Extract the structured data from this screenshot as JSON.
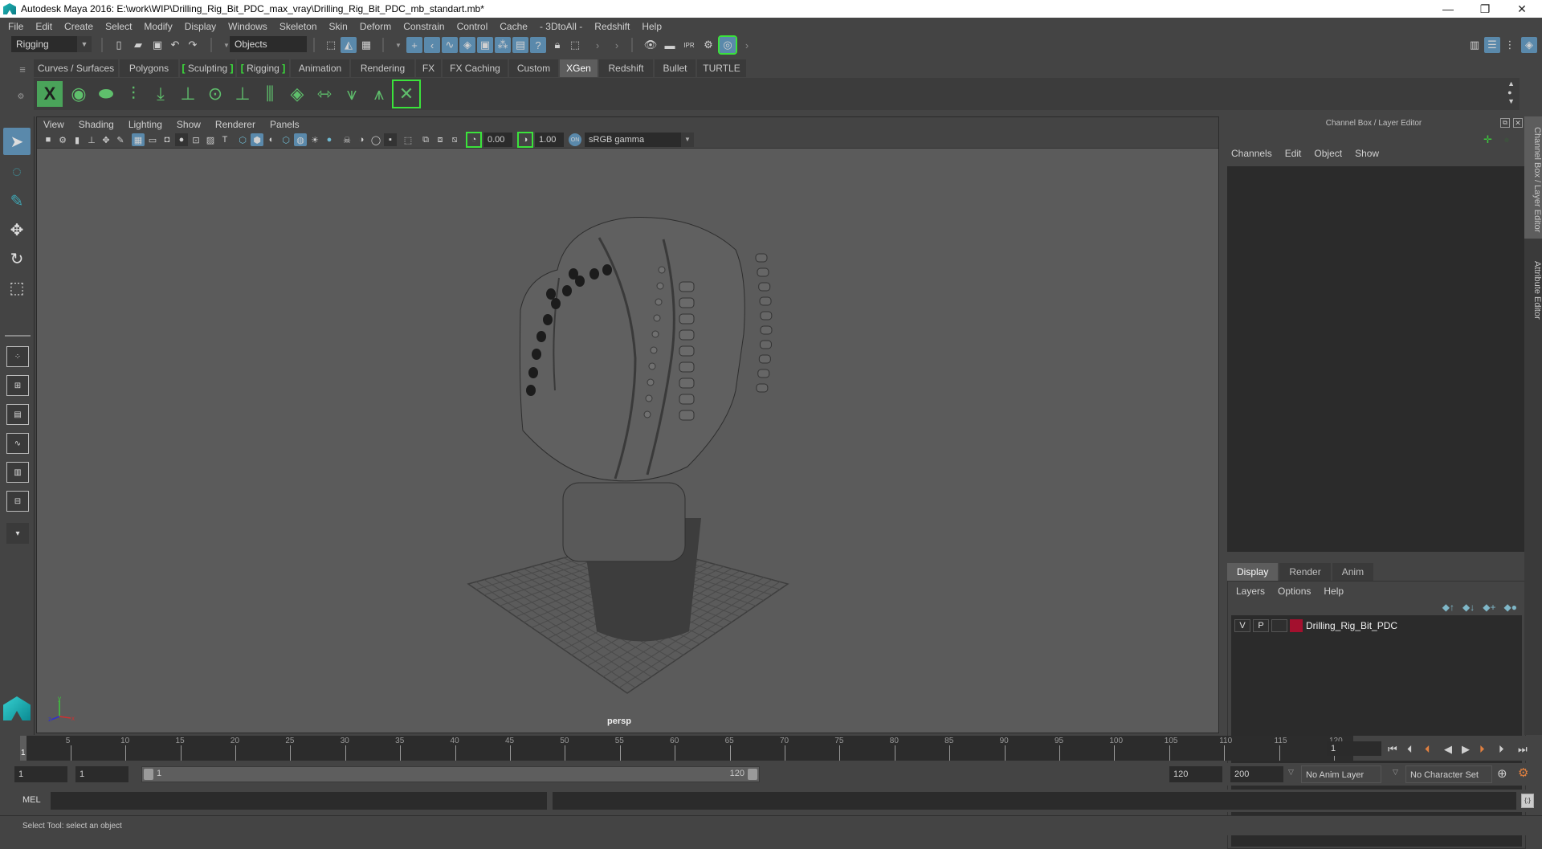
{
  "window": {
    "title": "Autodesk Maya 2016: E:\\work\\WIP\\Drilling_Rig_Bit_PDC_max_vray\\Drilling_Rig_Bit_PDC_mb_standart.mb*",
    "minimize": "—",
    "restore": "❐",
    "close": "✕"
  },
  "menubar": [
    "File",
    "Edit",
    "Create",
    "Select",
    "Modify",
    "Display",
    "Windows",
    "Skeleton",
    "Skin",
    "Deform",
    "Constrain",
    "Control",
    "Cache",
    "- 3DtoAll -",
    "Redshift",
    "Help"
  ],
  "statusline": {
    "menuset": "Rigging",
    "selection_mode": "Objects"
  },
  "shelf": {
    "tabs": [
      "Curves / Surfaces",
      "Polygons",
      "Sculpting",
      "Rigging",
      "Animation",
      "Rendering",
      "FX",
      "FX Caching",
      "Custom",
      "XGen",
      "Redshift",
      "Bullet",
      "TURTLE"
    ],
    "active_tab": "XGen",
    "icons": [
      "xgen-window-icon",
      "show-xgen-icon",
      "hide-xgen-icon",
      "create-description-icon",
      "place-guides-icon",
      "add-guide-icon",
      "toggle-guide-visibility-icon",
      "lock-guides-icon",
      "split-guides-icon",
      "paint-fur-icon",
      "groom-guides-icon",
      "select-guides-icon",
      "guide-bounds-icon",
      "delete-xgen-icon"
    ]
  },
  "viewport": {
    "menu": [
      "View",
      "Shading",
      "Lighting",
      "Show",
      "Renderer",
      "Panels"
    ],
    "exposure": "0.00",
    "gamma": "1.00",
    "color_space": "sRGB gamma",
    "camera_label": "persp",
    "axis": {
      "x": "x",
      "y": "y",
      "z": "z"
    }
  },
  "channel_box": {
    "title": "Channel Box / Layer Editor",
    "menu": [
      "Channels",
      "Edit",
      "Object",
      "Show"
    ]
  },
  "layer_editor": {
    "tabs": [
      "Display",
      "Render",
      "Anim"
    ],
    "active_tab": "Display",
    "menu": [
      "Layers",
      "Options",
      "Help"
    ],
    "layers": [
      {
        "visible": "V",
        "playback": "P",
        "name": "Drilling_Rig_Bit_PDC",
        "color": "#a3102e"
      }
    ]
  },
  "side_tabs": [
    "Channel Box / Layer Editor",
    "Attribute Editor"
  ],
  "timeline": {
    "ticks": [
      5,
      10,
      15,
      20,
      25,
      30,
      35,
      40,
      45,
      50,
      55,
      60,
      65,
      70,
      75,
      80,
      85,
      90,
      95,
      100,
      105,
      110,
      115,
      120
    ],
    "current_frame": "1",
    "current_frame_field": "1",
    "playback_buttons": [
      "⏮",
      "⏴|",
      "|◀",
      "◀",
      "▶",
      "▶|",
      "|⏵",
      "⏭"
    ]
  },
  "range": {
    "start": "1",
    "playback_start": "1",
    "slider_start": "1",
    "slider_end": "120",
    "playback_end": "120",
    "end": "200",
    "anim_layer": "No Anim Layer",
    "character_set": "No Character Set"
  },
  "command_line": {
    "label": "MEL",
    "input": "",
    "output": ""
  },
  "help_line": "Select Tool: select an object",
  "colors": {
    "accent": "#5a89ab",
    "shelf_green": "#5fbf6c",
    "bracket_green": "#3be33b",
    "viewport_bg": "#5b5b5b"
  }
}
